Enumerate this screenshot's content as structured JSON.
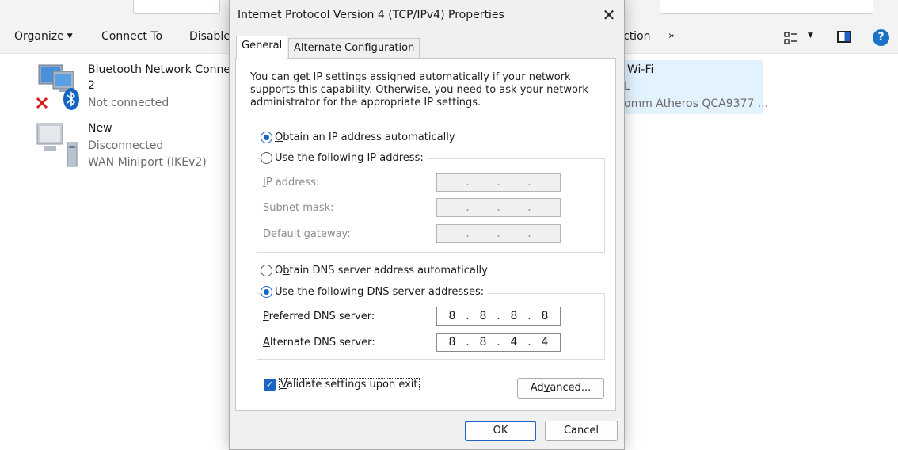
{
  "explorer": {
    "commands": {
      "organize": "Organize",
      "connect_to": "Connect To",
      "disable": "Disable",
      "action_partial": "ction",
      "more": "»"
    },
    "connections": [
      {
        "name_line1": "Bluetooth Network Connec",
        "name_line2": "2",
        "status": "Not connected"
      },
      {
        "name_line1": "New",
        "status": "Disconnected",
        "device": "WAN Miniport (IKEv2)"
      }
    ],
    "wifi": {
      "name": "Wi-Fi",
      "line2": "L",
      "device": "omm Atheros QCA9377 ..."
    }
  },
  "dialog": {
    "title": "Internet Protocol Version 4 (TCP/IPv4) Properties",
    "close_glyph": "✕",
    "tabs": [
      {
        "label": "General",
        "active": true
      },
      {
        "label": "Alternate Configuration",
        "active": false
      }
    ],
    "info_text": "You can get IP settings assigned automatically if your network supports this capability. Otherwise, you need to ask your network administrator for the appropriate IP settings.",
    "ip_mode": {
      "auto_label_key": "O",
      "auto_label_rest": "btain an IP address automatically",
      "manual_label_pre": "U",
      "manual_label_key": "s",
      "manual_label_rest": "e the following IP address:",
      "selected": "auto"
    },
    "ip_fields": [
      {
        "label_key": "I",
        "label_rest": "P address:",
        "octets": [
          "",
          "",
          "",
          ""
        ]
      },
      {
        "label_key": "S",
        "label_rest": "ubnet mask:",
        "octets": [
          "",
          "",
          "",
          ""
        ]
      },
      {
        "label_key": "D",
        "label_rest": "efault gateway:",
        "octets": [
          "",
          "",
          "",
          ""
        ]
      }
    ],
    "dns_mode": {
      "auto_label_pre": "O",
      "auto_label_key": "b",
      "auto_label_rest": "tain DNS server address automatically",
      "manual_label_pre": "Us",
      "manual_label_key": "e",
      "manual_label_rest": " the following DNS server addresses:",
      "selected": "manual"
    },
    "dns_fields": [
      {
        "label_key": "P",
        "label_rest": "referred DNS server:",
        "octets": [
          "8",
          "8",
          "8",
          "8"
        ]
      },
      {
        "label_key": "A",
        "label_rest": "lternate DNS server:",
        "octets": [
          "8",
          "8",
          "4",
          "4"
        ]
      }
    ],
    "validate": {
      "checked": true,
      "check_glyph": "✓",
      "label_pre": "",
      "label_key": "V",
      "label_rest": "alidate settings upon exit"
    },
    "buttons": {
      "advanced_pre": "Ad",
      "advanced_key": "v",
      "advanced_rest": "anced...",
      "ok": "OK",
      "cancel": "Cancel"
    }
  },
  "colors": {
    "accent": "#1a66c2",
    "dialog_bg": "#f0f0f0",
    "panel_bg": "#ffffff"
  }
}
